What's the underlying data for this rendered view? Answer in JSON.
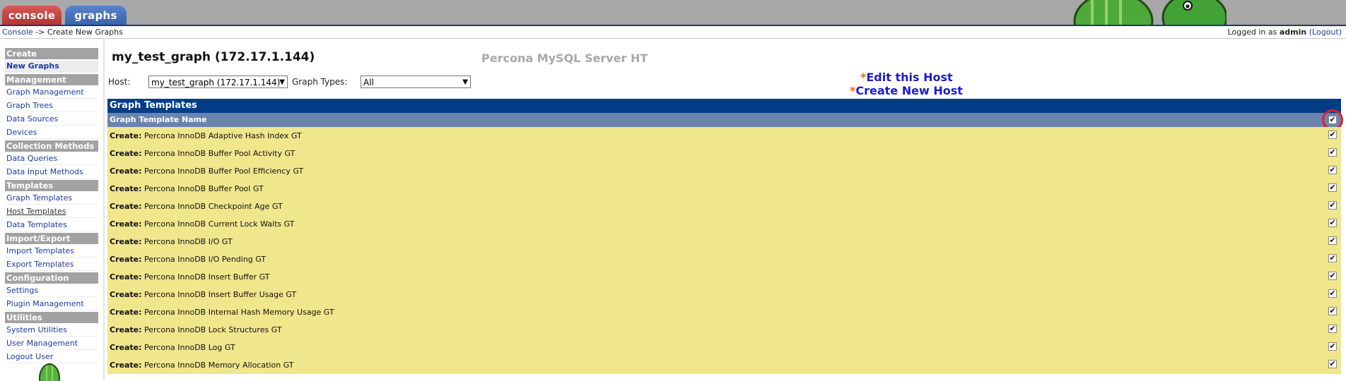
{
  "tabs": {
    "console": "console",
    "graphs": "graphs"
  },
  "breadcrumb": {
    "root": "Console",
    "separator": " -> ",
    "current": "Create New Graphs"
  },
  "login": {
    "prefix": "Logged in as ",
    "user": "admin",
    "logout": "(Logout)"
  },
  "sidebar": {
    "sections": [
      {
        "heading": "Create",
        "items": [
          "New Graphs"
        ]
      },
      {
        "heading": "Management",
        "items": [
          "Graph Management",
          "Graph Trees",
          "Data Sources",
          "Devices"
        ]
      },
      {
        "heading": "Collection Methods",
        "items": [
          "Data Queries",
          "Data Input Methods"
        ]
      },
      {
        "heading": "Templates",
        "items": [
          "Graph Templates",
          "Host Templates",
          "Data Templates"
        ]
      },
      {
        "heading": "Import/Export",
        "items": [
          "Import Templates",
          "Export Templates"
        ]
      },
      {
        "heading": "Configuration",
        "items": [
          "Settings",
          "Plugin Management"
        ]
      },
      {
        "heading": "Utilities",
        "items": [
          "System Utilities",
          "User Management",
          "Logout User"
        ]
      }
    ]
  },
  "host": {
    "title": "my_test_graph (172.17.1.144)",
    "description": "Percona MySQL Server HT",
    "label": "Host:",
    "selected": "my_test_graph (172.17.1.144)",
    "graph_types_label": "Graph Types:",
    "graph_types_selected": "All",
    "edit_link": "Edit this Host",
    "create_link": "Create New Host",
    "star": "*"
  },
  "table": {
    "heading": "Graph Templates",
    "column": "Graph Template Name",
    "row_prefix": "Create:",
    "rows": [
      "Percona InnoDB Adaptive Hash Index GT",
      "Percona InnoDB Buffer Pool Activity GT",
      "Percona InnoDB Buffer Pool Efficiency GT",
      "Percona InnoDB Buffer Pool GT",
      "Percona InnoDB Checkpoint Age GT",
      "Percona InnoDB Current Lock Waits GT",
      "Percona InnoDB I/O GT",
      "Percona InnoDB I/O Pending GT",
      "Percona InnoDB Insert Buffer GT",
      "Percona InnoDB Insert Buffer Usage GT",
      "Percona InnoDB Internal Hash Memory Usage GT",
      "Percona InnoDB Lock Structures GT",
      "Percona InnoDB Log GT",
      "Percona InnoDB Memory Allocation GT"
    ],
    "checked_glyph": "✔"
  },
  "colors": {
    "accent": "#003d87",
    "row_bg": "#f0e68c",
    "highlight": "#e0202a"
  }
}
